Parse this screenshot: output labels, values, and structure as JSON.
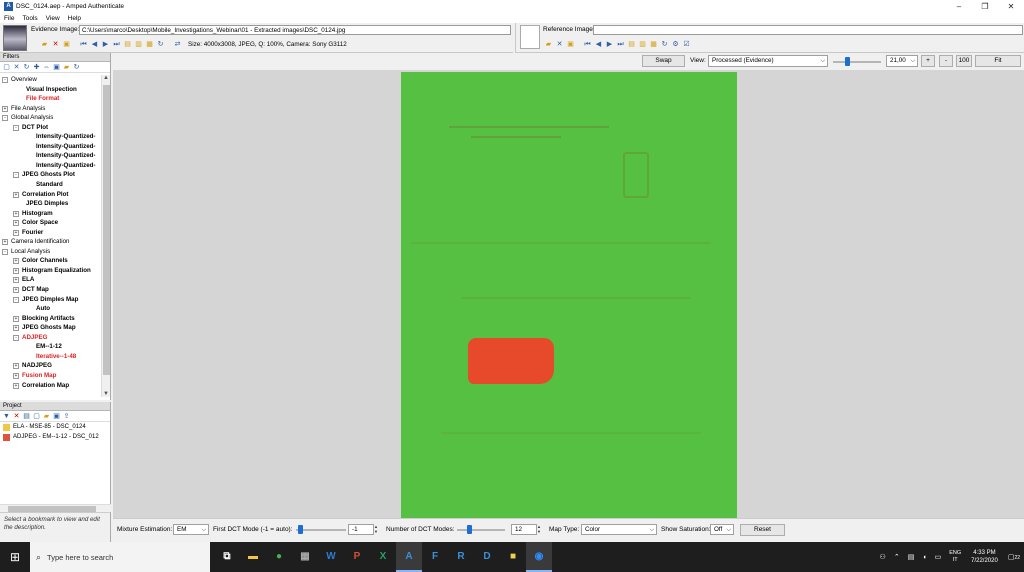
{
  "window": {
    "title": "DSC_0124.aep - Amped Authenticate",
    "app_icon": "amped-logo-icon",
    "controls": [
      "–",
      "❐",
      "✕"
    ]
  },
  "menu": [
    "File",
    "Tools",
    "View",
    "Help"
  ],
  "evidence": {
    "label": "Evidence Image:",
    "path": "C:\\Users\\marco\\Desktop\\Mobile_Investigations_Webinar\\01 - Extracted images\\DSC_0124.jpg",
    "info": "Size: 4000x3008, JPEG, Q: 100%, Camera: Sony G3112"
  },
  "reference": {
    "label": "Reference Image:",
    "path": ""
  },
  "filters": {
    "title": "Filters",
    "tree": [
      {
        "label": "Overview",
        "level": 0,
        "exp": "-",
        "bold": false,
        "red": false
      },
      {
        "label": "Visual Inspection",
        "level": 2,
        "exp": "",
        "bold": true,
        "red": false
      },
      {
        "label": "File Format",
        "level": 2,
        "exp": "",
        "bold": true,
        "red": true
      },
      {
        "label": "File Analysis",
        "level": 0,
        "exp": "+",
        "bold": false,
        "red": false
      },
      {
        "label": "Global Analysis",
        "level": 0,
        "exp": "-",
        "bold": false,
        "red": false
      },
      {
        "label": "DCT Plot",
        "level": 1,
        "exp": "-",
        "bold": true,
        "red": false
      },
      {
        "label": "Intensity-Quantized-",
        "level": 3,
        "exp": "",
        "bold": true,
        "red": false
      },
      {
        "label": "Intensity-Quantized-",
        "level": 3,
        "exp": "",
        "bold": true,
        "red": false
      },
      {
        "label": "Intensity-Quantized-",
        "level": 3,
        "exp": "",
        "bold": true,
        "red": false
      },
      {
        "label": "Intensity-Quantized-",
        "level": 3,
        "exp": "",
        "bold": true,
        "red": false
      },
      {
        "label": "JPEG Ghosts Plot",
        "level": 1,
        "exp": "-",
        "bold": true,
        "red": false
      },
      {
        "label": "Standard",
        "level": 3,
        "exp": "",
        "bold": true,
        "red": false
      },
      {
        "label": "Correlation Plot",
        "level": 1,
        "exp": "+",
        "bold": true,
        "red": false
      },
      {
        "label": "JPEG Dimples",
        "level": 2,
        "exp": "",
        "bold": true,
        "red": false
      },
      {
        "label": "Histogram",
        "level": 1,
        "exp": "+",
        "bold": true,
        "red": false
      },
      {
        "label": "Color Space",
        "level": 1,
        "exp": "+",
        "bold": true,
        "red": false
      },
      {
        "label": "Fourier",
        "level": 1,
        "exp": "+",
        "bold": true,
        "red": false
      },
      {
        "label": "Camera Identification",
        "level": 0,
        "exp": "+",
        "bold": false,
        "red": false
      },
      {
        "label": "Local Analysis",
        "level": 0,
        "exp": "-",
        "bold": false,
        "red": false
      },
      {
        "label": "Color Channels",
        "level": 1,
        "exp": "+",
        "bold": true,
        "red": false
      },
      {
        "label": "Histogram Equalization",
        "level": 1,
        "exp": "+",
        "bold": true,
        "red": false
      },
      {
        "label": "ELA",
        "level": 1,
        "exp": "+",
        "bold": true,
        "red": false
      },
      {
        "label": "DCT Map",
        "level": 1,
        "exp": "+",
        "bold": true,
        "red": false
      },
      {
        "label": "JPEG Dimples Map",
        "level": 1,
        "exp": "-",
        "bold": true,
        "red": false
      },
      {
        "label": "Auto",
        "level": 3,
        "exp": "",
        "bold": true,
        "red": false
      },
      {
        "label": "Blocking Artifacts",
        "level": 1,
        "exp": "+",
        "bold": true,
        "red": false
      },
      {
        "label": "JPEG Ghosts Map",
        "level": 1,
        "exp": "+",
        "bold": true,
        "red": false
      },
      {
        "label": "ADJPEG",
        "level": 1,
        "exp": "-",
        "bold": true,
        "red": true
      },
      {
        "label": "EM--1-12",
        "level": 3,
        "exp": "",
        "bold": true,
        "red": false
      },
      {
        "label": "Iterative--1-48",
        "level": 3,
        "exp": "",
        "bold": true,
        "red": true
      },
      {
        "label": "NADJPEG",
        "level": 1,
        "exp": "+",
        "bold": true,
        "red": false
      },
      {
        "label": "Fusion Map",
        "level": 1,
        "exp": "+",
        "bold": true,
        "red": true
      },
      {
        "label": "Correlation Map",
        "level": 1,
        "exp": "+",
        "bold": true,
        "red": false
      }
    ]
  },
  "project": {
    "title": "Project",
    "items": [
      {
        "label": "ELA - MSE-85 - DSC_0124",
        "color": "#f2c744"
      },
      {
        "label": "ADJPEG - EM--1-12 - DSC_012",
        "color": "#e0533a"
      }
    ]
  },
  "hint": "Select a bookmark to view and edit the description.",
  "viewer": {
    "swap": "Swap",
    "view_label": "View:",
    "view_value": "Processed (Evidence)",
    "zoom_value": "21,00",
    "zoom_level": 0.3,
    "plus": "+",
    "minus": "-",
    "hundred": "100",
    "fit": "Fit"
  },
  "controls": {
    "mixture_label": "Mixture Estimation:",
    "mixture_value": "EM",
    "first_dct_label": "First DCT Mode (-1 = auto):",
    "first_dct_value": "-1",
    "num_modes_label": "Number of DCT Modes:",
    "num_modes_value": "12",
    "map_type_label": "Map Type:",
    "map_type_value": "Color",
    "saturation_label": "Show Saturation:",
    "saturation_value": "Off",
    "reset": "Reset"
  },
  "taskbar": {
    "search_placeholder": "Type here to search",
    "apps": [
      {
        "name": "task-view-icon",
        "glyph": "⧉",
        "color": "#fff"
      },
      {
        "name": "file-explorer-icon",
        "glyph": "▬",
        "color": "#f2c744"
      },
      {
        "name": "chrome-icon",
        "glyph": "●",
        "color": "#4caf50"
      },
      {
        "name": "calculator-icon",
        "glyph": "▦",
        "color": "#aaa"
      },
      {
        "name": "word-icon",
        "glyph": "W",
        "color": "#2b7cd3"
      },
      {
        "name": "powerpoint-icon",
        "glyph": "P",
        "color": "#d35230"
      },
      {
        "name": "excel-icon",
        "glyph": "X",
        "color": "#21a366"
      },
      {
        "name": "amped-authenticate-icon",
        "glyph": "A",
        "color": "#3b8fd6",
        "active": true
      },
      {
        "name": "amped-five-icon",
        "glyph": "F",
        "color": "#3b8fd6"
      },
      {
        "name": "amped-replay-icon",
        "glyph": "R",
        "color": "#3b8fd6"
      },
      {
        "name": "amped-dvrconv-icon",
        "glyph": "D",
        "color": "#3b8fd6"
      },
      {
        "name": "sticky-notes-icon",
        "glyph": "■",
        "color": "#f2d04a"
      },
      {
        "name": "zoom-icon",
        "glyph": "◉",
        "color": "#2d8cff",
        "active": true
      }
    ],
    "lang_top": "ENG",
    "lang_bottom": "IT",
    "time": "4:33 PM",
    "date": "7/22/2020",
    "notif": "22"
  }
}
